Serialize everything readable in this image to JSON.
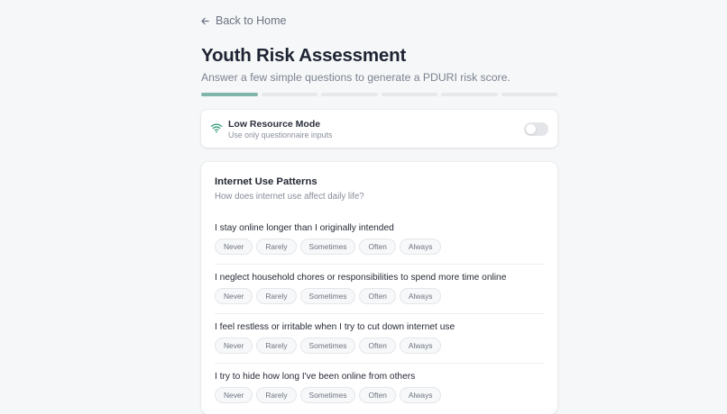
{
  "nav": {
    "back_label": "Back to Home"
  },
  "header": {
    "title": "Youth Risk Assessment",
    "subtitle": "Answer a few simple questions to generate a PDURI risk score."
  },
  "progress": {
    "total_steps": 6,
    "current_step": 1,
    "accent": "#7fb5aa"
  },
  "low_resource": {
    "title": "Low Resource Mode",
    "description": "Use only questionnaire inputs",
    "enabled": false,
    "icon": "wifi-icon",
    "icon_color": "#3ea07f"
  },
  "section": {
    "title": "Internet Use Patterns",
    "description": "How does internet use affect daily life?",
    "options": [
      "Never",
      "Rarely",
      "Sometimes",
      "Often",
      "Always"
    ],
    "questions": [
      "I stay online longer than I originally intended",
      "I neglect household chores or responsibilities to spend more time online",
      "I feel restless or irritable when I try to cut down internet use",
      "I try to hide how long I've been online from others"
    ]
  }
}
